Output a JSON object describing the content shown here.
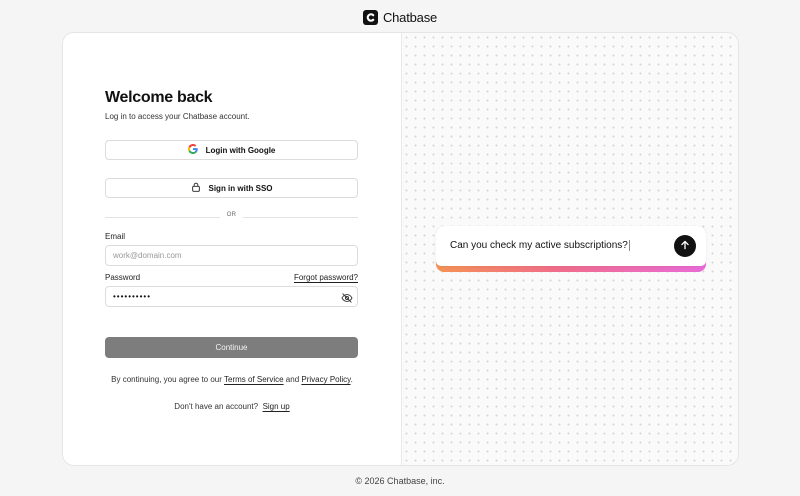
{
  "brand": {
    "name": "Chatbase",
    "logo_icon": "chatbase-c-logo"
  },
  "login": {
    "title": "Welcome back",
    "subtitle": "Log in to access your Chatbase account.",
    "google_label": "Login with Google",
    "sso_label": "Sign in with SSO",
    "divider_text": "OR",
    "email_label": "Email",
    "email_placeholder": "work@domain.com",
    "email_value": "",
    "password_label": "Password",
    "password_value": "••••••••••",
    "forgot_label": "Forgot password?",
    "continue_label": "Continue",
    "terms_prefix": "By continuing, you agree to our ",
    "terms_link": "Terms of Service",
    "terms_and": " and ",
    "privacy_link": "Privacy Policy",
    "terms_suffix": ".",
    "signup_prefix": "Don't have an account?",
    "signup_link": "Sign up"
  },
  "preview": {
    "chat_text": "Can you check my active subscriptions?",
    "send_icon": "arrow-up-icon"
  },
  "footer": {
    "text": "© 2026 Chatbase, inc."
  },
  "colors": {
    "continue_bg": "#7d7d7d",
    "gradient_start": "#f59355",
    "gradient_end": "#e86bd8",
    "text": "#111111"
  }
}
